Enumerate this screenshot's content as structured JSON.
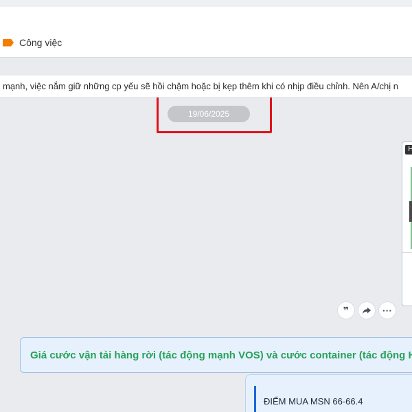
{
  "header": {
    "tag_label": "Công việc",
    "tag_color": "#f57c00"
  },
  "pinned": {
    "text": "mạnh, việc nắm giữ những cp yếu sẽ hồi chậm hoặc bị kẹp thêm khi có nhịp điều chỉnh. Nên A/chị n"
  },
  "chat": {
    "date_separator": "19/06/2025",
    "highlight_color": "#e0121b",
    "media_badge": "H",
    "reactions": [
      {
        "icon": "quote-icon",
        "glyph": "❞"
      },
      {
        "icon": "share-icon"
      },
      {
        "icon": "more-icon",
        "glyph": "···"
      }
    ],
    "link_card_title": "Giá cước vận tải hàng rời (tác động mạnh VOS) và cước container (tác động H",
    "quote_message": "ĐIỂM MUA MSN 66-66.4"
  }
}
